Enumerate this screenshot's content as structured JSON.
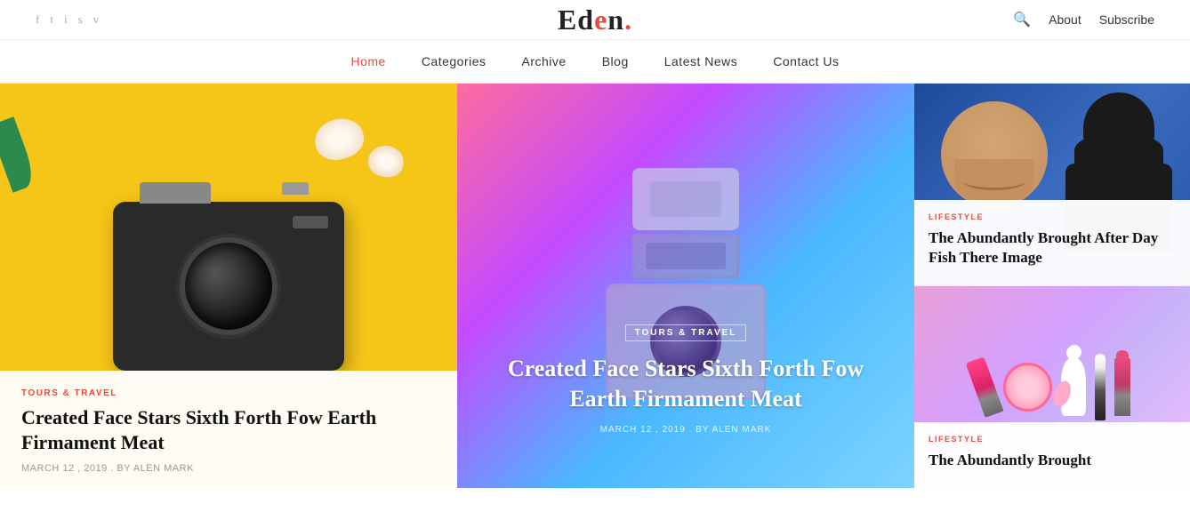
{
  "site": {
    "logo_text": "Eden",
    "logo_dot": "."
  },
  "header": {
    "social_icons": [
      {
        "name": "facebook-icon",
        "symbol": "f"
      },
      {
        "name": "twitter-icon",
        "symbol": "t"
      },
      {
        "name": "instagram-icon",
        "symbol": "i"
      },
      {
        "name": "skype-icon",
        "symbol": "s"
      },
      {
        "name": "vimeo-icon",
        "symbol": "v"
      }
    ],
    "search_label": "🔍",
    "about_label": "About",
    "subscribe_label": "Subscribe"
  },
  "nav": {
    "items": [
      {
        "label": "Home",
        "active": true
      },
      {
        "label": "Categories",
        "active": false
      },
      {
        "label": "Archive",
        "active": false
      },
      {
        "label": "Blog",
        "active": false
      },
      {
        "label": "Latest News",
        "active": false
      },
      {
        "label": "Contact Us",
        "active": false
      }
    ]
  },
  "cards": {
    "left": {
      "category": "TOURS & TRAVEL",
      "title": "Created Face Stars Sixth Forth Fow Earth Firmament Meat",
      "meta": "MARCH 12 , 2019 . BY ALEN MARK"
    },
    "center": {
      "category": "TOURS & TRAVEL",
      "title": "Created Face Stars Sixth Forth Fow Earth Firmament Meat",
      "meta": "MARCH 12 , 2019 . BY ALEN MARK"
    },
    "right_top": {
      "category": "LIFESTYLE",
      "title": "The Abundantly Brought After Day Fish There Image"
    },
    "right_bottom": {
      "category": "LIFESTYLE",
      "title": "The Abundantly Brought"
    }
  },
  "colors": {
    "accent": "#e74c3c",
    "dark": "#111111",
    "gray": "#999999",
    "nav_active": "#e74c3c"
  }
}
